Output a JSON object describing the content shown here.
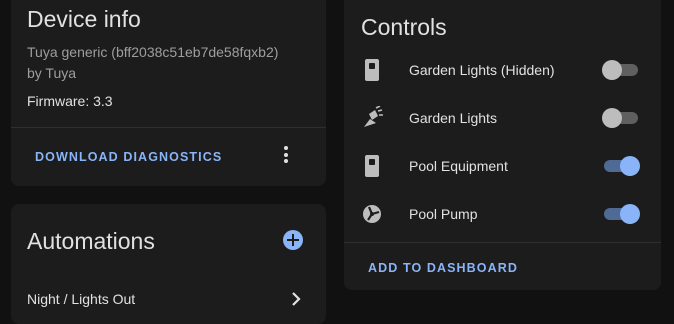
{
  "device_info": {
    "title": "Device info",
    "model": "Tuya generic (bff2038c51eb7de58fqxb2)",
    "manufacturer": "by Tuya",
    "firmware": "Firmware: 3.3",
    "download_label": "DOWNLOAD DIAGNOSTICS",
    "more_icon": "dots-vertical-icon"
  },
  "automations": {
    "title": "Automations",
    "add_icon": "plus-circle-icon",
    "items": [
      {
        "label": "Night / Lights Out",
        "icon": "chevron-right-icon"
      }
    ]
  },
  "controls": {
    "title": "Controls",
    "items": [
      {
        "label": "Garden Lights (Hidden)",
        "icon": "switch-box-icon",
        "state": "off"
      },
      {
        "label": "Garden Lights",
        "icon": "light-flood-icon",
        "state": "off"
      },
      {
        "label": "Pool Equipment",
        "icon": "switch-box-icon",
        "state": "on"
      },
      {
        "label": "Pool Pump",
        "icon": "pump-icon",
        "state": "on"
      }
    ],
    "add_label": "ADD TO DASHBOARD"
  },
  "colors": {
    "background": "#111111",
    "card": "#1c1c1c",
    "accent": "#8ab4f8",
    "toggle_off_knob": "#bdbdbd",
    "toggle_on_track": "#4f6a94"
  }
}
